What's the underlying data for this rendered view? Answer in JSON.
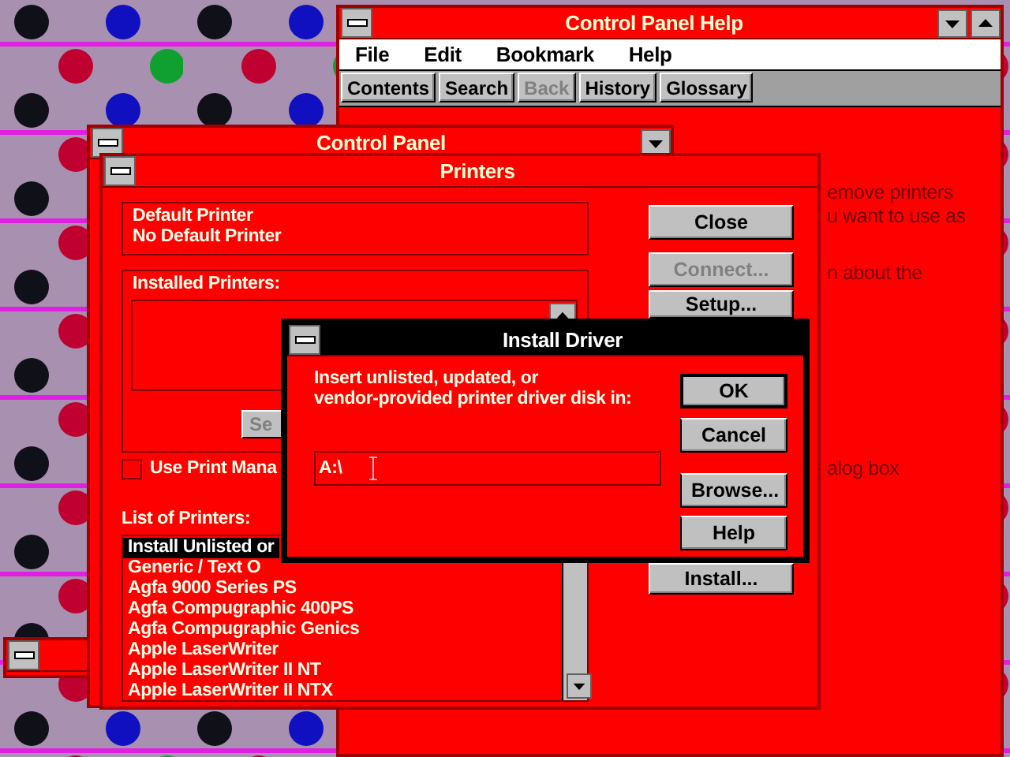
{
  "help_window": {
    "title": "Control Panel Help",
    "menu": [
      "File",
      "Edit",
      "Bookmark",
      "Help"
    ],
    "buttons": [
      {
        "label": "Contents",
        "disabled": false
      },
      {
        "label": "Search",
        "disabled": false
      },
      {
        "label": "Back",
        "disabled": true
      },
      {
        "label": "History",
        "disabled": false
      },
      {
        "label": "Glossary",
        "disabled": false
      }
    ],
    "text_fragments": [
      "emove printers",
      "u want to use as",
      "n about the",
      "alog box"
    ]
  },
  "control_panel": {
    "title": "Control Panel"
  },
  "printers": {
    "title": "Printers",
    "default_printer": {
      "label": "Default Printer",
      "value": "No Default Printer"
    },
    "installed_printers": {
      "label": "Installed Printers:",
      "button_fragment": "Se"
    },
    "use_print_manager": {
      "label": "Use Print Mana",
      "checked": false
    },
    "list_label": "List of Printers:",
    "list": [
      {
        "label": "Install Unlisted or",
        "selected": true
      },
      {
        "label": "Generic / Text O",
        "selected": false
      },
      {
        "label": "Agfa 9000 Series PS",
        "selected": false
      },
      {
        "label": "Agfa Compugraphic 400PS",
        "selected": false
      },
      {
        "label": "Agfa Compugraphic Genics",
        "selected": false
      },
      {
        "label": "Apple LaserWriter",
        "selected": false
      },
      {
        "label": "Apple LaserWriter II NT",
        "selected": false
      },
      {
        "label": "Apple LaserWriter II NTX",
        "selected": false
      }
    ],
    "buttons": [
      {
        "label": "Close",
        "disabled": false
      },
      {
        "label": "Connect...",
        "disabled": true
      },
      {
        "label": "Setup...",
        "disabled": false
      },
      {
        "label": "Install...",
        "disabled": false
      }
    ]
  },
  "install_driver": {
    "title": "Install Driver",
    "prompt_lines": [
      "Insert unlisted, updated, or",
      "vendor-provided printer driver disk in:"
    ],
    "path": "A:\\",
    "buttons": [
      {
        "label": "OK",
        "default": true
      },
      {
        "label": "Cancel",
        "default": false
      },
      {
        "label": "Browse...",
        "default": false
      },
      {
        "label": "Help",
        "default": false
      }
    ]
  }
}
